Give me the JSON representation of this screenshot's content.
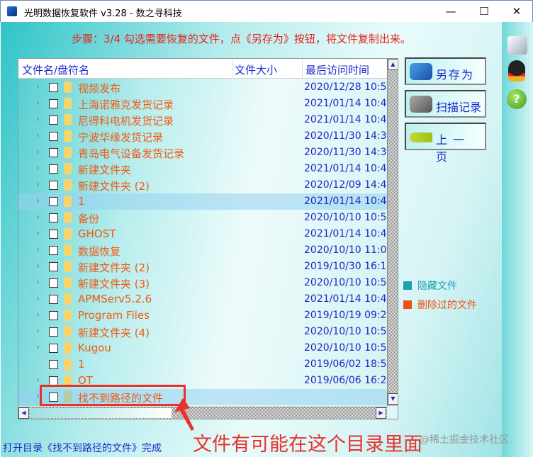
{
  "window": {
    "title": "光明数据恢复软件 v3.28 - 数之寻科技",
    "minimize": "—",
    "maximize": "☐",
    "close": "✕"
  },
  "step_text": "步骤：3/4 勾选需要恢复的文件，点《另存为》按钮，将文件复制出来。",
  "columns": {
    "name": "文件名/盘符名",
    "size": "文件大小",
    "time": "最后访问时间"
  },
  "rows": [
    {
      "name": "视频发布",
      "time": "2020/12/28 10:5",
      "expand": true
    },
    {
      "name": "上海诺雅克发货记录",
      "time": "2021/01/14 10:4",
      "expand": true
    },
    {
      "name": "尼得科电机发货记录",
      "time": "2021/01/14 10:4",
      "expand": true
    },
    {
      "name": "宁波华缘发货记录",
      "time": "2020/11/30 14:3",
      "expand": true
    },
    {
      "name": "青岛电气设备发货记录",
      "time": "2020/11/30 14:3",
      "expand": true
    },
    {
      "name": "新建文件夹",
      "time": "2021/01/14 10:4",
      "expand": true
    },
    {
      "name": "新建文件夹 (2)",
      "time": "2020/12/09 14:4",
      "expand": true
    },
    {
      "name": "1",
      "time": "2021/01/14 10:4",
      "expand": true,
      "selected": true
    },
    {
      "name": "备份",
      "time": "2020/10/10 10:5",
      "expand": true
    },
    {
      "name": "GHOST",
      "time": "2021/01/14 10:4",
      "expand": true
    },
    {
      "name": "数据恢复",
      "time": "2020/10/10 11:0",
      "expand": true
    },
    {
      "name": "新建文件夹 (2)",
      "time": "2019/10/30 16:1",
      "expand": true
    },
    {
      "name": "新建文件夹 (3)",
      "time": "2020/10/10 10:5",
      "expand": true
    },
    {
      "name": "APMServ5.2.6",
      "time": "2021/01/14 10:4",
      "expand": true
    },
    {
      "name": "Program Files",
      "time": "2019/10/19 09:2",
      "expand": true
    },
    {
      "name": "新建文件夹 (4)",
      "time": "2020/10/10 10:5",
      "expand": true
    },
    {
      "name": "Kugou",
      "time": "2020/10/10 10:5",
      "expand": true
    },
    {
      "name": "1",
      "time": "2019/06/02 18:5",
      "expand": false
    },
    {
      "name": "OT",
      "time": "2019/06/06 16:2",
      "expand": true
    },
    {
      "name": "找不到路径的文件",
      "time": "",
      "expand": true,
      "selected": true,
      "grey": true
    }
  ],
  "buttons": {
    "save_as": "另存为",
    "scan_log": "扫描记录",
    "prev": "上一页"
  },
  "legend": {
    "hidden": "隐藏文件",
    "deleted": "删除过的文件",
    "hidden_color": "#1aa0b0",
    "deleted_color": "#f05014"
  },
  "status": "打开目录《找不到路径的文件》完成",
  "annotation": "文件有可能在这个目录里面",
  "watermark": "@稀土掘金技术社区"
}
